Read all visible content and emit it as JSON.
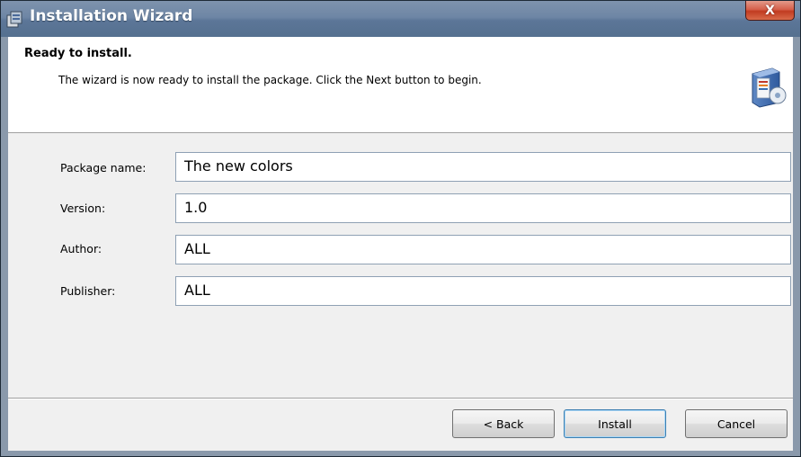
{
  "window": {
    "title": "Installation Wizard",
    "title_icon": "installer-box-icon",
    "close_label": "X"
  },
  "header": {
    "title": "Ready to install.",
    "description": "The wizard is now ready to install the package. Click the Next button to begin.",
    "icon": "install-package-icon"
  },
  "form": {
    "package_name": {
      "label": "Package name:",
      "value": "The new colors"
    },
    "version": {
      "label": "Version:",
      "value": "1.0"
    },
    "author": {
      "label": "Author:",
      "value": "ALL"
    },
    "publisher": {
      "label": "Publisher:",
      "value": "ALL"
    }
  },
  "buttons": {
    "back": "< Back",
    "install": "Install",
    "cancel": "Cancel"
  },
  "colors": {
    "titlebar": "#6e86a5",
    "close_button": "#c13b21",
    "client_background": "#f0f0f0"
  }
}
